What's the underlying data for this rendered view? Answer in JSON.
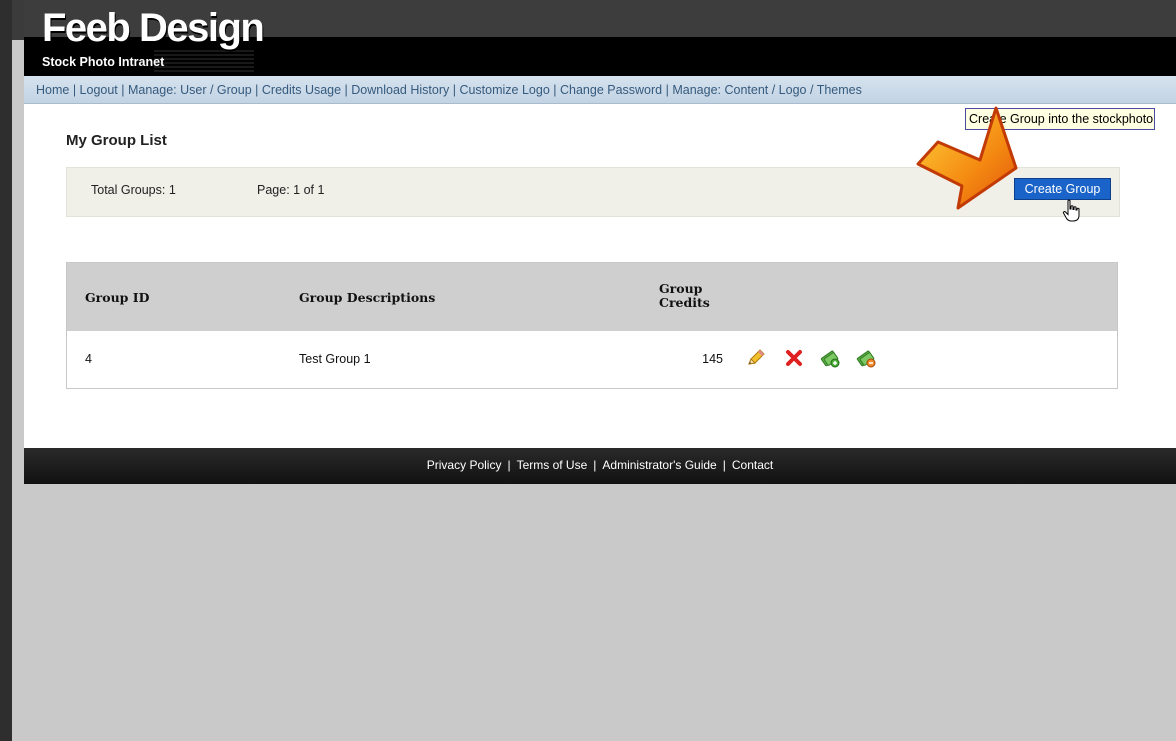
{
  "header": {
    "title": "Feeb Design",
    "subtitle": "Stock Photo Intranet"
  },
  "nav": {
    "items": [
      {
        "label": "Home"
      },
      {
        "label": "Logout"
      },
      {
        "label": "Manage:  User"
      },
      {
        "label": "Group"
      },
      {
        "label": "Credits Usage"
      },
      {
        "label": "Download History"
      },
      {
        "label": "Customize Logo"
      },
      {
        "label": "Change Password"
      },
      {
        "label": "Manage:  Content"
      },
      {
        "label": "Logo"
      },
      {
        "label": "Themes"
      }
    ]
  },
  "main": {
    "title": "My Group List",
    "total_groups": "Total Groups: 1",
    "page_info": "Page: 1 of 1",
    "create_button": "Create Group",
    "tooltip": "Create Group into the stockphoto"
  },
  "table": {
    "headers": {
      "id": "Group ID",
      "desc": "Group Descriptions",
      "credits_line1": "Group",
      "credits_line2": "Credits"
    },
    "rows": [
      {
        "id": "4",
        "desc": "Test Group 1",
        "credits": "145"
      }
    ],
    "action_icons": [
      "edit-icon",
      "delete-icon",
      "add-credits-icon",
      "remove-credits-icon"
    ]
  },
  "footer": {
    "links": [
      {
        "label": "Privacy Policy"
      },
      {
        "label": "Terms of Use"
      },
      {
        "label": "Administrator's Guide"
      },
      {
        "label": "Contact"
      }
    ]
  },
  "colors": {
    "accent": "#1a63c9",
    "nav_text": "#355a7d",
    "arrow": "#f07a10"
  }
}
